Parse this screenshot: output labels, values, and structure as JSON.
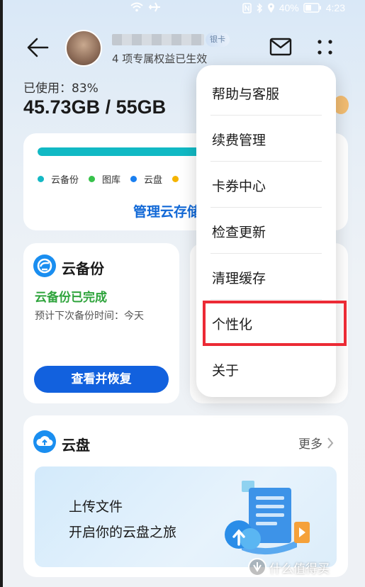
{
  "status_bar": {
    "battery": "40%",
    "time": "4:23"
  },
  "header": {
    "benefits_text": "4 项专属权益已生效",
    "member_tag": "银卡"
  },
  "storage": {
    "used_label": "已使用：83%",
    "used_fraction": 0.83,
    "amount": "45.73GB / 55GB",
    "legend": [
      {
        "label": "云备份",
        "color": "#14b8c4"
      },
      {
        "label": "图库",
        "color": "#37c24b"
      },
      {
        "label": "云盘",
        "color": "#1a7ff0"
      },
      {
        "label": "",
        "color": "#f5b400"
      }
    ],
    "manage_link": "管理云存储"
  },
  "backup_card": {
    "title": "云备份",
    "status": "云备份已完成",
    "next_backup": "预计下次备份时间：今天",
    "restore_button": "查看并恢复"
  },
  "drive_card": {
    "title": "云盘",
    "more_label": "更多",
    "banner_line1": "上传文件",
    "banner_line2": "开启你的云盘之旅"
  },
  "menu": {
    "items": [
      {
        "label": "帮助与客服"
      },
      {
        "label": "续费管理"
      },
      {
        "label": "卡券中心"
      },
      {
        "label": "检查更新"
      },
      {
        "label": "清理缓存"
      },
      {
        "label": "个性化"
      },
      {
        "label": "关于"
      }
    ]
  },
  "watermark": "什么值得买",
  "colors": {
    "accent": "#1261de",
    "success": "#2fa43c",
    "highlight": "#ec2a35"
  }
}
